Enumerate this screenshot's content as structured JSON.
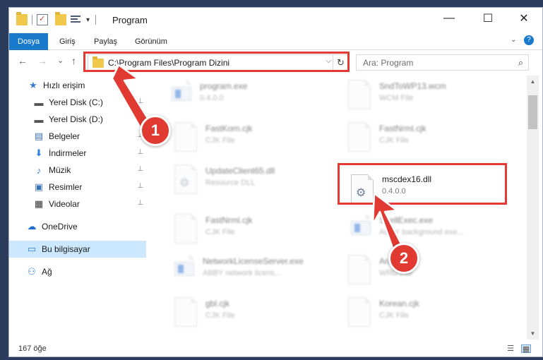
{
  "window": {
    "title": "Program",
    "controls": {
      "minimize": "—",
      "maximize": "☐",
      "close": "✕"
    }
  },
  "ribbon": {
    "tabs": [
      {
        "label": "Dosya",
        "active": true
      },
      {
        "label": "Giriş"
      },
      {
        "label": "Paylaş"
      },
      {
        "label": "Görünüm"
      }
    ],
    "help": "?"
  },
  "nav": {
    "back": "←",
    "forward": "→",
    "recent": "⌄",
    "up": "↑",
    "address": "C:\\Program Files\\Program Dizini",
    "dropdown": "⌵",
    "refresh": "↻",
    "search_placeholder": "Ara: Program",
    "search_icon": "⌕"
  },
  "sidebar": {
    "items": [
      {
        "label": "Hızlı erişim",
        "icon": "star-icon",
        "glyph": "★",
        "color": "#3a7bd5"
      },
      {
        "label": "Yerel Disk (C:)",
        "icon": "drive-icon",
        "glyph": "▬",
        "color": "#555",
        "pin": "📌"
      },
      {
        "label": "Yerel Disk (D:)",
        "icon": "drive-icon",
        "glyph": "▬",
        "color": "#555",
        "pin": "📌"
      },
      {
        "label": "Belgeler",
        "icon": "documents-icon",
        "glyph": "▤",
        "color": "#3a6fb0",
        "pin": "📌"
      },
      {
        "label": "İndirmeler",
        "icon": "downloads-icon",
        "glyph": "⬇",
        "color": "#2c7fd8",
        "pin": "📌"
      },
      {
        "label": "Müzik",
        "icon": "music-icon",
        "glyph": "♪",
        "color": "#2c7fd8",
        "pin": "📌"
      },
      {
        "label": "Resimler",
        "icon": "pictures-icon",
        "glyph": "▣",
        "color": "#3a6fb0",
        "pin": "📌"
      },
      {
        "label": "Videolar",
        "icon": "videos-icon",
        "glyph": "▦",
        "color": "#333",
        "pin": "📌"
      },
      {
        "label": "OneDrive",
        "icon": "cloud-icon",
        "glyph": "☁",
        "color": "#1e6fd0"
      },
      {
        "label": "Bu bilgisayar",
        "icon": "computer-icon",
        "glyph": "▭",
        "color": "#2c7fd8",
        "selected": true
      },
      {
        "label": "Ağ",
        "icon": "network-icon",
        "glyph": "⚇",
        "color": "#2c7fd8"
      }
    ]
  },
  "files": [
    {
      "name": "program.exe",
      "sub": "0.4.0.0",
      "kind": "exe",
      "blur": true
    },
    {
      "name": "SndToWP13.wcm",
      "sub": "WCM File",
      "kind": "doc",
      "blur": true
    },
    {
      "name": "FastKorn.cjk",
      "sub": "CJK File",
      "kind": "doc",
      "blur": true
    },
    {
      "name": "FastNrml.cjk",
      "sub": "CJK File",
      "kind": "doc",
      "blur": true
    },
    {
      "name": "UpdateClient65.dll",
      "sub": "Resource DLL",
      "kind": "dll",
      "blur": true
    },
    {
      "name": "mscdex16.dll",
      "sub": "0.4.0.0",
      "kind": "dll",
      "blur": false
    },
    {
      "name": "FastNrml.cjk",
      "sub": "CJK File",
      "kind": "doc",
      "blur": true
    },
    {
      "name": "ShellExec.exe",
      "sub": "ABBY background exe...",
      "kind": "exe",
      "blur": true
    },
    {
      "name": "NetworkLicenseServer.exe",
      "sub": "ABBY network licens...",
      "kind": "exe",
      "blur": true
    },
    {
      "name": "Arab.cjk",
      "sub": "WRD File",
      "kind": "doc",
      "blur": true
    },
    {
      "name": "gbl.cjk",
      "sub": "CJK File",
      "kind": "doc",
      "blur": true
    },
    {
      "name": "Korean.cjk",
      "sub": "CJK File",
      "kind": "doc",
      "blur": true
    }
  ],
  "status": {
    "count": "167 öğe"
  },
  "callouts": [
    {
      "label": "1"
    },
    {
      "label": "2"
    }
  ],
  "colors": {
    "accent": "#1979ca",
    "highlight": "#e53935",
    "selection": "#cce8ff"
  }
}
